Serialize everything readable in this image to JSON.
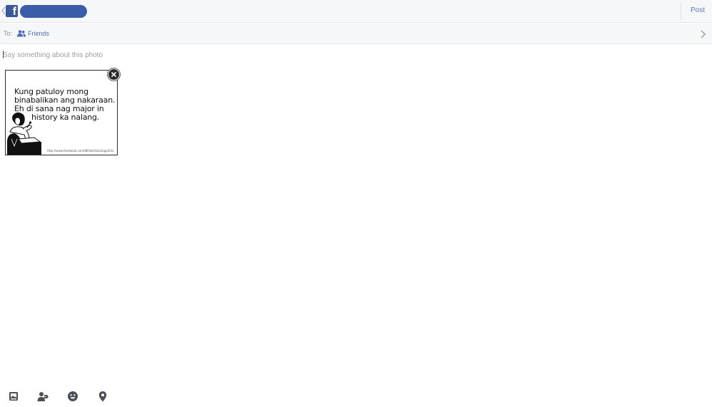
{
  "header": {
    "back_icon": "chevron-left-icon",
    "logo_icon": "facebook-logo-icon",
    "logo_glyph": "f",
    "post_label": "Post",
    "brand_color": "#3b5998",
    "accent_color": "#5b7bc0"
  },
  "audience": {
    "to_label": "To:",
    "audience_label": "Friends",
    "audience_icon": "friends-icon",
    "chevron_icon": "chevron-right-icon"
  },
  "composer": {
    "placeholder": "Say something about this photo",
    "value": ""
  },
  "attachment": {
    "caption_lines": [
      "Kung patuloy mong",
      "binabalikan ang nakaraan.",
      "Eh di sana nag major in",
      "history ka nalang."
    ],
    "watermark_url": "http://www.facebook.com/WilliamSantiago2ma",
    "remove_icon": "close-icon"
  },
  "toolbar": {
    "items": [
      {
        "icon": "photo-icon",
        "label": "Add photo"
      },
      {
        "icon": "tag-people-icon",
        "label": "Tag people"
      },
      {
        "icon": "smiley-icon",
        "label": "Feeling"
      },
      {
        "icon": "location-pin-icon",
        "label": "Check in"
      }
    ]
  }
}
